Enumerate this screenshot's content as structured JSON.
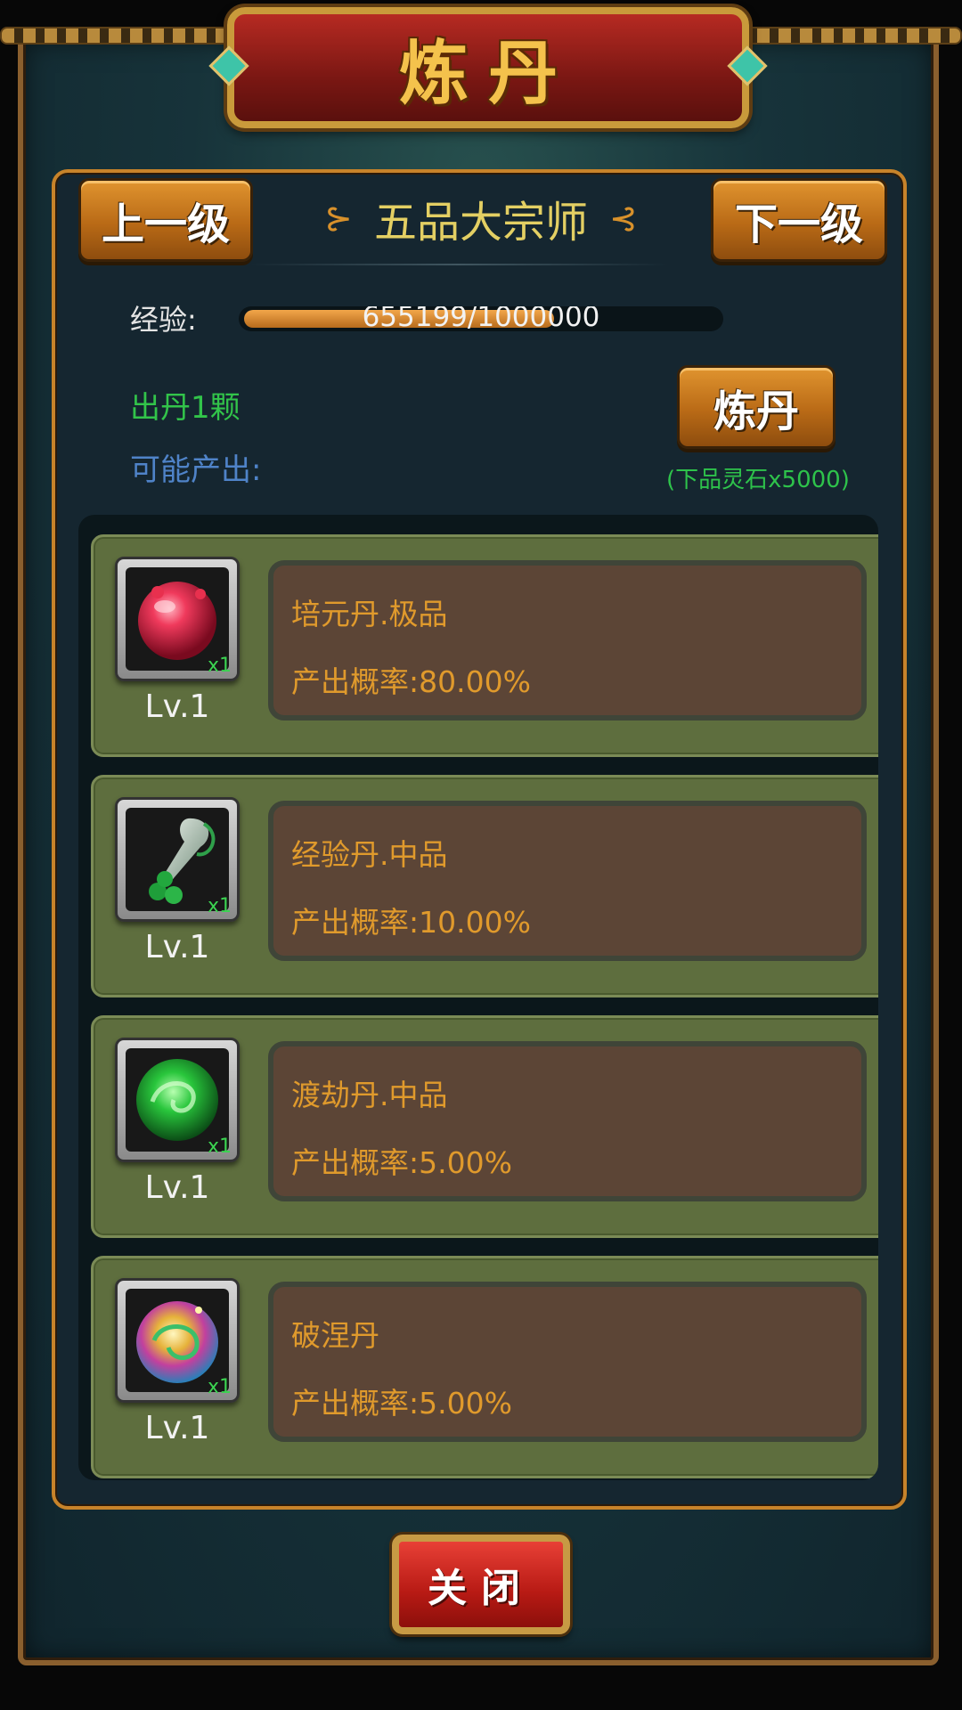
{
  "header": {
    "title": "炼丹"
  },
  "nav": {
    "prev_label": "上一级",
    "next_label": "下一级",
    "rank_title": "五品大宗师"
  },
  "exp": {
    "label": "经验:",
    "value": "655199/1000000",
    "progress": 0.655
  },
  "refine": {
    "yield_text": "出丹1颗",
    "possible_label": "可能产出:",
    "button_label": "炼丹",
    "cost_text": "(下品灵石x5000)"
  },
  "items": [
    {
      "name": "培元丹.极品",
      "rate": "产出概率:80.00%",
      "level": "Lv.1",
      "qty": "x1",
      "icon": "red-pill-icon"
    },
    {
      "name": "经验丹.中品",
      "rate": "产出概率:10.00%",
      "level": "Lv.1",
      "qty": "x1",
      "icon": "jade-ladle-icon"
    },
    {
      "name": "渡劫丹.中品",
      "rate": "产出概率:5.00%",
      "level": "Lv.1",
      "qty": "x1",
      "icon": "green-orb-icon"
    },
    {
      "name": "破涅丹",
      "rate": "产出概率:5.00%",
      "level": "Lv.1",
      "qty": "x1",
      "icon": "rainbow-orb-icon"
    }
  ],
  "footer": {
    "close_label": "关闭"
  },
  "colors": {
    "frame": "#8a5f2e",
    "panel_border": "#c7832a",
    "item_bg": "#5e6e3e",
    "info_bg": "#5c4536",
    "text_orange": "#e09a2c",
    "text_green": "#32c44a"
  }
}
